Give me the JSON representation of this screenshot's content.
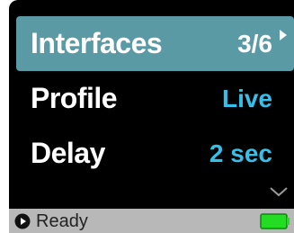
{
  "menu": {
    "items": [
      {
        "label": "Interfaces",
        "value": "3/6",
        "selected": true
      },
      {
        "label": "Profile",
        "value": "Live",
        "selected": false
      },
      {
        "label": "Delay",
        "value": "2 sec",
        "selected": false
      }
    ]
  },
  "status": {
    "text": "Ready",
    "icon": "play-circle-icon",
    "battery_icon": "battery-icon",
    "battery_color": "#22dd22"
  },
  "colors": {
    "selected_bg": "#5a9aa4",
    "value_accent": "#35c0ea",
    "screen_bg": "#000000",
    "status_bg": "#b8b8b8"
  },
  "icons": {
    "more_indicator": "chevron-down-icon",
    "submenu_indicator": "arrow-right-icon"
  }
}
